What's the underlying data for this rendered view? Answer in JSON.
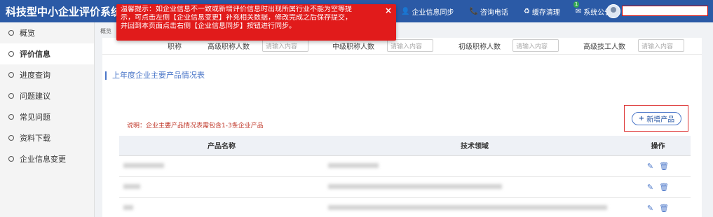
{
  "app": {
    "title": "科技型中小企业评价系统"
  },
  "header": {
    "links": [
      {
        "icon": "user-icon",
        "glyph": "👤",
        "label": "企业信息同步"
      },
      {
        "icon": "phone-icon",
        "glyph": "📞",
        "label": "咨询电话"
      },
      {
        "icon": "recycle-icon",
        "glyph": "♻",
        "label": "缓存清理"
      },
      {
        "icon": "mail-icon",
        "glyph": "✉",
        "label": "系统公告",
        "badge": "1"
      }
    ],
    "user_name": ""
  },
  "sidebar": {
    "items": [
      {
        "label": "概览"
      },
      {
        "label": "评价信息"
      },
      {
        "label": "进度查询"
      },
      {
        "label": "问题建议"
      },
      {
        "label": "常见问题"
      },
      {
        "label": "资料下载"
      },
      {
        "label": "企业信息变更"
      }
    ]
  },
  "breadcrumb": "概览",
  "title_row": {
    "label": "职称",
    "fields": [
      {
        "label": "高级职称人数",
        "placeholder": "请输入内容"
      },
      {
        "label": "中级职称人数",
        "placeholder": "请输入内容"
      },
      {
        "label": "初级职称人数",
        "placeholder": "请输入内容"
      },
      {
        "label": "高级技工人数",
        "placeholder": "请输入内容"
      }
    ]
  },
  "section": {
    "title": "上年度企业主要产品情况表",
    "note": "说明：企业主要产品情况表需包含1-3条企业产品",
    "add_button": "新增产品"
  },
  "table": {
    "headers": [
      "产品名称",
      "技术领域",
      "操作"
    ]
  },
  "toast": {
    "lines": [
      "温馨提示：如企业信息不一致或新增评价信息时出现所属行业不能为空等提",
      "示，可点击左侧【企业信息变更】补充相关数据，修改完成之后保存提交，",
      "并回到本页面点击右侧【企业信息同步】按钮进行同步。"
    ],
    "close": "×"
  },
  "colors": {
    "header": "#2b5aa6",
    "toast": "#e11b1b",
    "accent": "#4a76c8",
    "note": "#c0392b"
  }
}
